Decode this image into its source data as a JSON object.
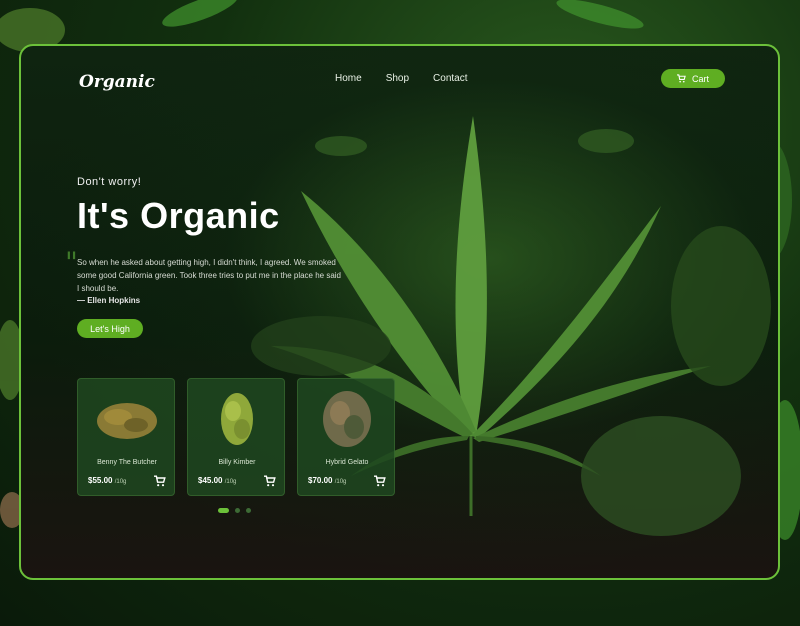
{
  "brand": {
    "logo": "Organic"
  },
  "nav": {
    "items": [
      "Home",
      "Shop",
      "Contact"
    ]
  },
  "cart": {
    "label": "Cart",
    "icon": "cart-icon"
  },
  "hero": {
    "eyebrow": "Don't worry!",
    "title": "It's Organic",
    "quote": "So when he asked about getting high, I didn't think, I agreed. We smoked some good California green. Took three tries to put me in the place he said I should be.",
    "author": "— Ellen Hopkins",
    "cta": "Let's High"
  },
  "products": [
    {
      "name": "Benny The Butcher",
      "price": "$55.00",
      "unit": "/10g",
      "bud_color": "#8a7a35"
    },
    {
      "name": "Billy Kimber",
      "price": "$45.00",
      "unit": "/10g",
      "bud_color": "#8fa83a"
    },
    {
      "name": "Hybrid Gelato",
      "price": "$70.00",
      "unit": "/10g",
      "bud_color": "#6f6a4a"
    }
  ],
  "carousel": {
    "count": 3,
    "active": 0
  },
  "colors": {
    "accent": "#5fae22",
    "border": "#6cc13a",
    "card": "#1e4820"
  }
}
